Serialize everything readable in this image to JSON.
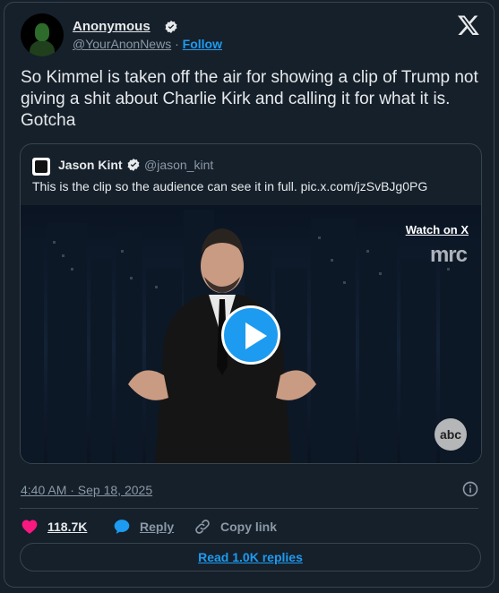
{
  "author": {
    "display_name": "Anonymous",
    "handle": "@YourAnonNews",
    "separator": " · ",
    "follow_label": "Follow"
  },
  "tweet": {
    "text": "So Kimmel is taken off the air for showing a clip of Trump not giving a shit about Charlie Kirk and calling it for what it is. Gotcha"
  },
  "quoted": {
    "display_name": "Jason Kint",
    "handle": "@jason_kint",
    "text": "This is the clip so the audience can see it in full. pic.x.com/jzSvBJg0PG",
    "video": {
      "watch_label": "Watch on X",
      "watermark": "mrc",
      "network_logo": "abc"
    }
  },
  "meta": {
    "timestamp": "4:40 AM · Sep 18, 2025"
  },
  "actions": {
    "likes": "118.7K",
    "reply_label": "Reply",
    "copy_label": "Copy link"
  },
  "footer": {
    "read_replies_label": "Read 1.0K replies"
  },
  "colors": {
    "background": "#15202b",
    "accent": "#1d9bf0",
    "like": "#f91880",
    "border": "#38444d",
    "muted": "#8b98a5"
  },
  "icons": [
    "verified-badge-icon",
    "x-logo-icon",
    "play-icon",
    "info-icon",
    "heart-icon",
    "reply-bubble-icon",
    "link-icon"
  ]
}
